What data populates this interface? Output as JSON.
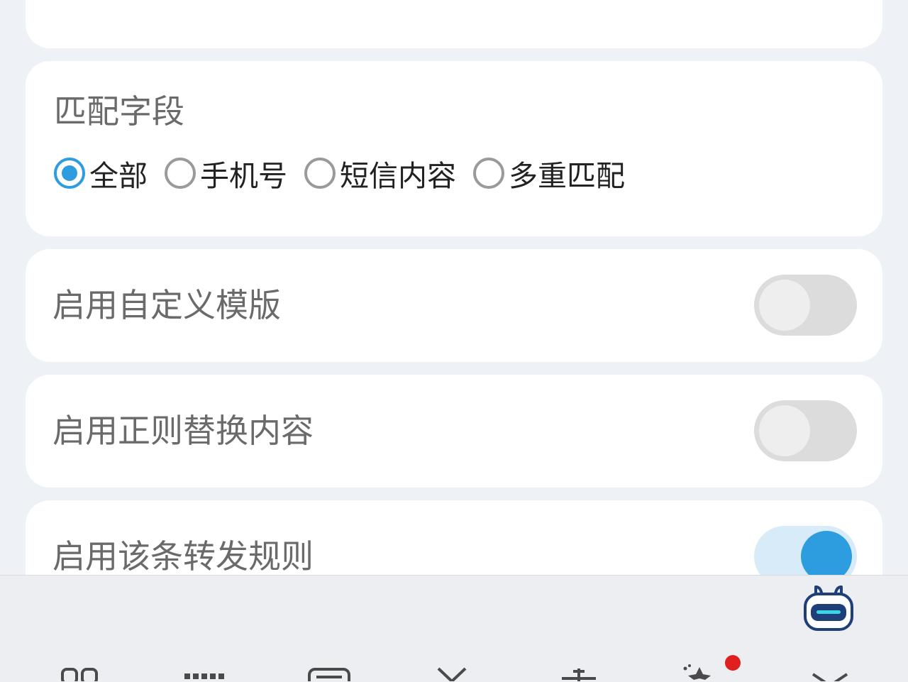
{
  "match_section": {
    "title": "匹配字段",
    "options": [
      {
        "label": "全部",
        "selected": true
      },
      {
        "label": "手机号",
        "selected": false
      },
      {
        "label": "短信内容",
        "selected": false
      },
      {
        "label": "多重匹配",
        "selected": false
      }
    ]
  },
  "settings": [
    {
      "label": "启用自定义模版",
      "enabled": false
    },
    {
      "label": "启用正则替换内容",
      "enabled": false
    },
    {
      "label": "启用该条转发规则",
      "enabled": true
    }
  ],
  "colors": {
    "accent": "#2e9de0",
    "toggle_off": "#dcdcdc",
    "toggle_on_track": "#d7ebf9",
    "notification": "#e0201f"
  },
  "keyboard": {
    "icons": [
      "apps-grid-icon",
      "keyboard-icon",
      "clipboard-icon",
      "cursor-icon",
      "text-cursor-icon",
      "sparkle-icon",
      "collapse-icon"
    ],
    "assistant": "robot-assistant-icon"
  }
}
